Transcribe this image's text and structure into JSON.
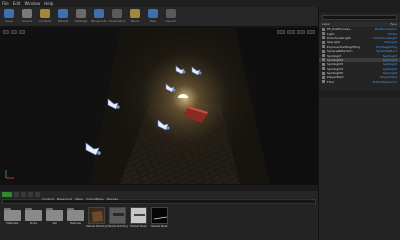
{
  "menu": [
    "File",
    "Edit",
    "Window",
    "Help"
  ],
  "toolbar": [
    {
      "icon": "save-icon",
      "label": "Save",
      "color": "#3f6fb0"
    },
    {
      "icon": "source-control-icon",
      "label": "Source",
      "color": "#7a7a7a"
    },
    {
      "icon": "content-icon",
      "label": "Content",
      "color": "#a08a3a"
    },
    {
      "icon": "marketplace-icon",
      "label": "Market",
      "color": "#3f6fb0"
    },
    {
      "icon": "settings-icon",
      "label": "Settings",
      "color": "#6a6a6a"
    },
    {
      "icon": "blueprints-icon",
      "label": "Blueprints",
      "color": "#3f6fb0"
    },
    {
      "icon": "cinematics-icon",
      "label": "Cinematics",
      "color": "#5a5a5a"
    },
    {
      "icon": "build-icon",
      "label": "Build",
      "color": "#a08a3a"
    },
    {
      "icon": "play-icon",
      "label": "Play",
      "color": "#3f6fb0"
    },
    {
      "icon": "launch-icon",
      "label": "Launch",
      "color": "#5a5a5a"
    }
  ],
  "outliner": {
    "columns": [
      "Label",
      "Type"
    ],
    "rows": [
      {
        "name": "PP_PostProcess...",
        "type": "PostProcessVol",
        "selected": false
      },
      {
        "name": "Light",
        "type": "Folder",
        "selected": false
      },
      {
        "name": "DirectionalLight",
        "type": "DirectionalLight",
        "selected": false
      },
      {
        "name": "SkyLight",
        "type": "SkyLight",
        "selected": false
      },
      {
        "name": "ExponentialHeightFog",
        "type": "ExpHeightFog",
        "selected": false
      },
      {
        "name": "SphereReflection",
        "type": "SphereReflect",
        "selected": false
      },
      {
        "name": "SpotLight",
        "type": "SpotLight",
        "selected": false
      },
      {
        "name": "SpotLight2",
        "type": "SpotLight",
        "selected": true
      },
      {
        "name": "SpotLight3",
        "type": "SpotLight",
        "selected": false
      },
      {
        "name": "SpotLight4",
        "type": "SpotLight",
        "selected": false
      },
      {
        "name": "SpotLight5",
        "type": "SpotLight",
        "selected": false
      },
      {
        "name": "PlayerStart",
        "type": "PlayerStart",
        "selected": false
      },
      {
        "name": "Floor",
        "type": "StaticMeshActor",
        "selected": false
      }
    ]
  },
  "content_browser": {
    "path": [
      "Content",
      "Basement",
      "Maps",
      "VirtualMaps",
      "Meshes"
    ],
    "assets": [
      {
        "name": "Materials",
        "kind": "folder"
      },
      {
        "name": "Props",
        "kind": "folder"
      },
      {
        "name": "Set",
        "kind": "folder"
      },
      {
        "name": "Textures",
        "kind": "folder"
      },
      {
        "name": "Market Building",
        "kind": "thumb-dark"
      },
      {
        "name": "Market Building",
        "kind": "thumb-gray"
      },
      {
        "name": "Market Mesh",
        "kind": "thumb-light"
      },
      {
        "name": "Market Mesh",
        "kind": "thumb-black"
      }
    ]
  }
}
